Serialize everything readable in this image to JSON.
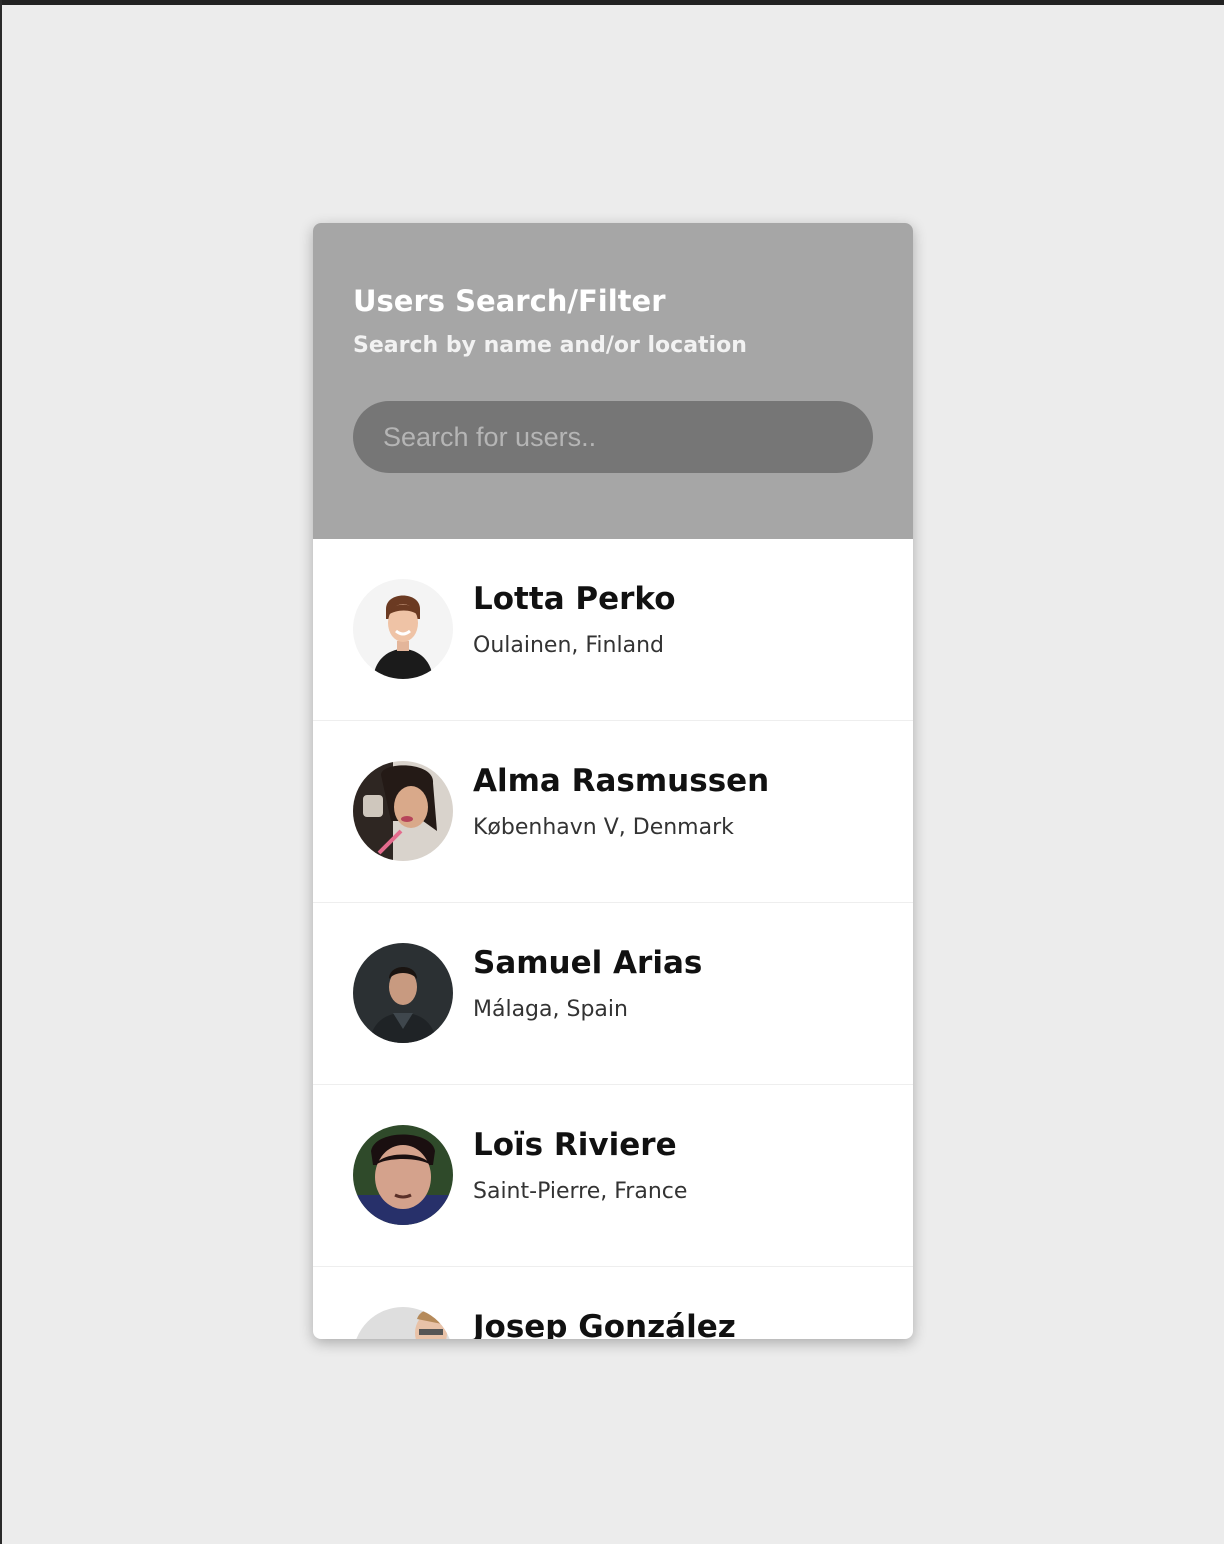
{
  "header": {
    "title": "Users Search/Filter",
    "subtitle": "Search by name and/or location"
  },
  "search": {
    "placeholder": "Search for users..",
    "value": ""
  },
  "users": [
    {
      "name": "Lotta Perko",
      "location": "Oulainen, Finland",
      "avatar_icon": "avatar-photo"
    },
    {
      "name": "Alma Rasmussen",
      "location": "København V, Denmark",
      "avatar_icon": "avatar-photo"
    },
    {
      "name": "Samuel Arias",
      "location": "Málaga, Spain",
      "avatar_icon": "avatar-photo"
    },
    {
      "name": "Loïs Riviere",
      "location": "Saint-Pierre, France",
      "avatar_icon": "avatar-photo"
    },
    {
      "name": "Josep González",
      "location": "",
      "avatar_icon": "avatar-photo"
    }
  ],
  "colors": {
    "page_background": "#ececec",
    "header_background": "#a6a6a6",
    "search_background": "#767676",
    "card_background": "#ffffff"
  }
}
